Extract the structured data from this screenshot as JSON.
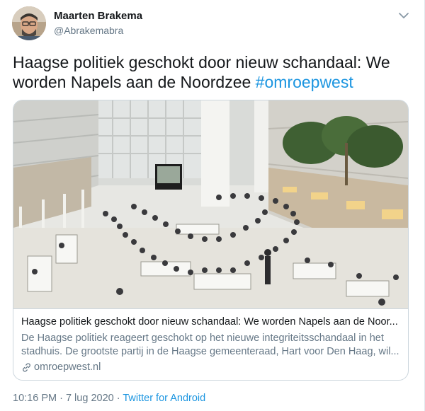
{
  "author": {
    "name": "Maarten Brakema",
    "handle": "@Abrakemabra"
  },
  "tweet": {
    "text": "Haagse politiek geschokt door nieuw schandaal: We worden Napels aan de Noordzee ",
    "hashtag": "#omroepwest"
  },
  "card": {
    "title": "Haagse politiek geschokt door nieuw schandaal: We worden Napels aan de Noor...",
    "description": "De Haagse politiek reageert geschokt op het nieuwe integriteitsschandaal in het stadhuis. De grootste partij in de Haagse gemeenteraad, Hart voor Den Haag, wil...",
    "domain": "omroepwest.nl"
  },
  "meta": {
    "time": "10:16 PM",
    "separator": " · ",
    "date": "7 lug 2020",
    "source": "Twitter for Android"
  },
  "icons": {
    "more": "chevron-down-icon",
    "link": "link-icon"
  },
  "colors": {
    "link": "#1b95e0",
    "secondary_text": "#657786",
    "border": "#ccd6dd"
  }
}
